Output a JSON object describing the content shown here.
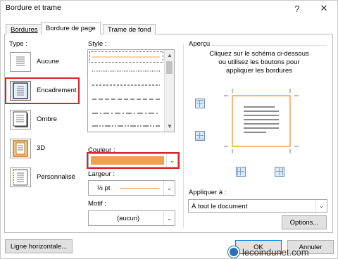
{
  "window": {
    "title": "Bordure et trame",
    "help_glyph": "?",
    "close_glyph": "✕"
  },
  "tabs": [
    {
      "label": "Bordures",
      "active": false
    },
    {
      "label": "Bordure de page",
      "active": true
    },
    {
      "label": "Trame de fond",
      "active": false
    }
  ],
  "type": {
    "label": "Type :",
    "options": [
      {
        "label": "Aucune",
        "selected": false
      },
      {
        "label": "Encadrement",
        "selected": true
      },
      {
        "label": "Ombre",
        "selected": false
      },
      {
        "label": "3D",
        "selected": false
      },
      {
        "label": "Personnalisé",
        "selected": false
      }
    ]
  },
  "style": {
    "label": "Style :",
    "selected_index": 0
  },
  "couleur": {
    "label": "Couleur :",
    "value_color": "#f0a050"
  },
  "largeur": {
    "label": "Largeur :",
    "value": "½ pt"
  },
  "motif": {
    "label": "Motif :",
    "value": "(aucun)"
  },
  "apercu": {
    "label": "Aperçu",
    "instructions": "Cliquez sur le schéma ci-dessous\nou utilisez les boutons pour\nappliquer les bordures"
  },
  "appliquer": {
    "label": "Appliquer à :",
    "value": "À tout le document"
  },
  "buttons": {
    "options": "Options...",
    "ligne_horizontale": "Ligne horizontale...",
    "ok": "OK",
    "annuler": "Annuler"
  },
  "watermark": {
    "text": "lecoindunet.com"
  },
  "colors": {
    "highlight_red": "#d9242a",
    "orange_line": "#f0a050",
    "accent_blue": "#0078d7"
  }
}
